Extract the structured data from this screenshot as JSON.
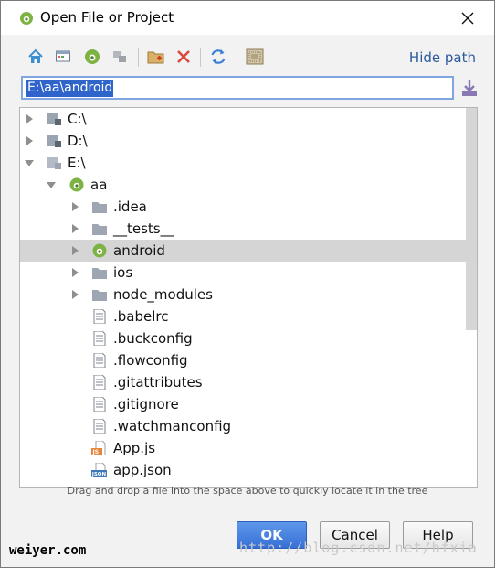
{
  "window": {
    "title": "Open File or Project",
    "close_icon": "close-icon"
  },
  "toolbar": {
    "buttons": [
      "home-icon",
      "desktop-icon",
      "project-icon",
      "module-icon",
      "new-folder-icon",
      "delete-icon",
      "refresh-icon",
      "show-hidden-icon"
    ],
    "hide_path_label": "Hide path"
  },
  "path": {
    "value": "E:\\aa\\android"
  },
  "tree": {
    "rows": [
      {
        "label": "C:\\",
        "icon": "drive-icon",
        "expander": "collapsed"
      },
      {
        "label": "D:\\",
        "icon": "drive-icon",
        "expander": "collapsed"
      },
      {
        "label": "E:\\",
        "icon": "drive-icon",
        "expander": "expanded"
      },
      {
        "label": "aa",
        "icon": "android-project-icon",
        "expander": "expanded"
      },
      {
        "label": ".idea",
        "icon": "folder-icon",
        "expander": "collapsed"
      },
      {
        "label": "__tests__",
        "icon": "folder-icon",
        "expander": "collapsed"
      },
      {
        "label": "android",
        "icon": "android-project-icon",
        "expander": "collapsed",
        "selected": true
      },
      {
        "label": "ios",
        "icon": "folder-icon",
        "expander": "collapsed"
      },
      {
        "label": "node_modules",
        "icon": "folder-icon",
        "expander": "collapsed"
      },
      {
        "label": ".babelrc",
        "icon": "text-file-icon"
      },
      {
        "label": ".buckconfig",
        "icon": "text-file-icon"
      },
      {
        "label": ".flowconfig",
        "icon": "text-file-icon"
      },
      {
        "label": ".gitattributes",
        "icon": "text-file-icon"
      },
      {
        "label": ".gitignore",
        "icon": "text-file-icon"
      },
      {
        "label": ".watchmanconfig",
        "icon": "text-file-icon"
      },
      {
        "label": "App.js",
        "icon": "js-file-icon"
      },
      {
        "label": "app.json",
        "icon": "json-file-icon"
      }
    ]
  },
  "hint": "Drag and drop a file into the space above to quickly locate it in the tree",
  "buttons": {
    "ok": "OK",
    "cancel": "Cancel",
    "help": "Help"
  },
  "watermarks": {
    "left": "weiyer.com",
    "right": "http://blog.csdn.net/hfxia"
  },
  "colors": {
    "accent": "#3670d6",
    "selection": "#d5d5d5",
    "link": "#2b5a9e",
    "android_green": "#7cb342"
  }
}
